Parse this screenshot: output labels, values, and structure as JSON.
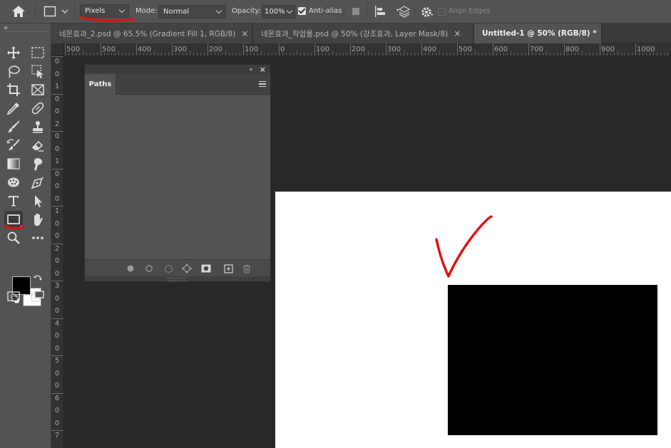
{
  "options_bar": {
    "shape_mode_value": "Pixels",
    "mode_label": "Mode:",
    "mode_value": "Normal",
    "opacity_label": "Opacity:",
    "opacity_value": "100%",
    "antialias_label": "Anti-alias",
    "antialias_checked": true,
    "align_edges_label": "Align Edges",
    "align_edges_checked": false
  },
  "tabs": [
    {
      "label": "네온효과_2.psd @ 65.5% (Gradient Fill 1, RGB/8)",
      "active": false
    },
    {
      "label": "네온효과_작업물.psd @ 50% (강조효과, Layer Mask/8)",
      "active": false
    },
    {
      "label": "Untitled-1 @ 50% (RGB/8) *",
      "active": true
    }
  ],
  "close_glyph": "×",
  "ruler_top_labels": [
    "500",
    "500",
    "400",
    "300",
    "200",
    "100",
    "0",
    "100",
    "200",
    "300",
    "400",
    "500",
    "600",
    "700",
    "800",
    "900",
    "1000"
  ],
  "ruler_left_labels": [
    "0",
    "0",
    "1",
    "0",
    "0",
    "2",
    "0",
    "0",
    "1",
    "0",
    "0",
    "0",
    "1",
    "0",
    "0",
    "2",
    "0",
    "0",
    "3",
    "0",
    "0",
    "4",
    "0",
    "0",
    "5",
    "0",
    "0",
    "6",
    "0",
    "0",
    "7"
  ],
  "paths_panel": {
    "tab_label": "Paths",
    "collapse_glyph": "«",
    "close_glyph": "×"
  },
  "toolbar": {
    "collapse_glyph": "«",
    "selected_tool": "rectangle-tool"
  },
  "colors": {
    "annotation_red": "#e01010",
    "foreground": "#000000",
    "background": "#ffffff",
    "panel_bg": "#535353",
    "canvas_bg": "#282828"
  }
}
